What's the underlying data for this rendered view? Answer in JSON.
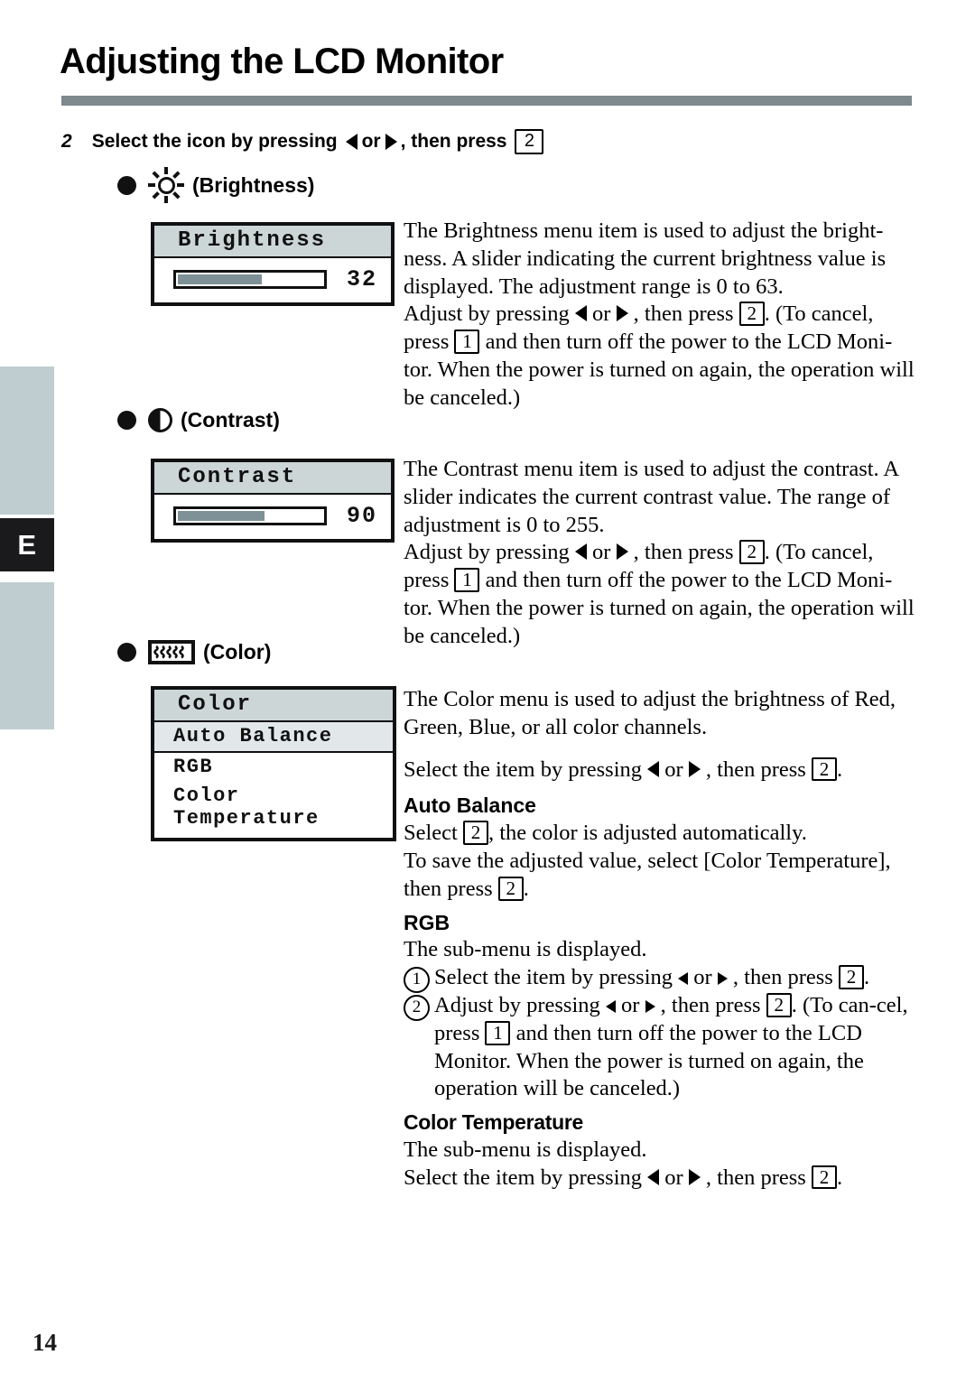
{
  "page": {
    "title": "Adjusting the LCD Monitor",
    "number": "14",
    "margin_tab_letter": "E"
  },
  "step": {
    "number": "2",
    "text_before_arrows": "Select the icon by pressing",
    "or_word": "or",
    "text_after_arrows": ", then press",
    "key": "2"
  },
  "sections": [
    {
      "id": "brightness",
      "icon": "sun-icon",
      "heading": "(Brightness)",
      "osd": {
        "title": "Brightness",
        "value": "32",
        "fill_percent": 58
      },
      "paragraphs": [
        "The Brightness menu item is used to adjust the bright-ness.  A slider indicating the current brightness value is displayed.  The adjustment range is 0 to 63.",
        "Adjust by pressing"
      ],
      "adjust_line": {
        "lead": "Adjust by pressing",
        "or_word": "or",
        "mid": ", then press",
        "key_confirm": "2",
        "after_key": ". (To cancel,",
        "second_lead": "press",
        "key_cancel": "1",
        "tail": "and then turn off the power to the LCD Moni-tor. When the power is turned on again, the operation will be canceled.)"
      }
    },
    {
      "id": "contrast",
      "icon": "contrast-icon",
      "heading": "(Contrast)",
      "osd": {
        "title": "Contrast",
        "value": "90",
        "fill_percent": 60
      },
      "paragraphs": [
        "The Contrast menu item is used to adjust the contrast.  A slider indicates the current contrast value.  The range of adjustment is 0 to 255."
      ],
      "adjust_line": {
        "lead": "Adjust by pressing",
        "or_word": "or",
        "mid": ", then press",
        "key_confirm": "2",
        "after_key": ". (To cancel,",
        "second_lead": "press",
        "key_cancel": "1",
        "tail": "and then turn off the power to the LCD Moni-tor. When the power is turned on again, the operation will be canceled.)"
      }
    },
    {
      "id": "color",
      "icon": "color-bars-icon",
      "heading": "(Color)",
      "osd_menu": {
        "title": "Color",
        "items": [
          {
            "label": "Auto Balance",
            "highlighted": true
          },
          {
            "label": "RGB",
            "highlighted": false
          },
          {
            "label": "Color Temperature",
            "highlighted": false
          }
        ]
      },
      "intro": "The Color menu is used to adjust the brightness of Red, Green, Blue, or all color channels.",
      "select_line": {
        "lead": "Select the item by pressing",
        "or_word": "or",
        "mid": ", then press",
        "key": "2",
        "tail": "."
      },
      "subsections": [
        {
          "title": "Auto Balance",
          "lines": [
            {
              "lead": "Select",
              "key": "2",
              "tail": ", the color is adjusted automatically."
            },
            {
              "lead": "To save the adjusted value, select [Color Temperature], then press",
              "key": "2",
              "tail": "."
            }
          ]
        },
        {
          "title": "RGB",
          "intro": "The sub-menu is displayed.",
          "items": [
            {
              "marker": "1",
              "lead": "Select the item by pressing",
              "or_word": "or",
              "mid": ", then press",
              "key": "2",
              "tail": "."
            },
            {
              "marker": "2",
              "lead": "Adjust by pressing",
              "or_word": "or",
              "mid": ", then press",
              "key": "2",
              "after_key": ". (To can-cel, press",
              "key_cancel": "1",
              "tail": "and then turn off the power to the LCD Monitor. When the power is turned on again, the operation will be canceled.)"
            }
          ]
        },
        {
          "title": "Color Temperature",
          "intro": "The sub-menu is displayed.",
          "select_line": {
            "lead": "Select the item by pressing",
            "or_word": "or",
            "mid": ", then press",
            "key": "2",
            "tail": "."
          }
        }
      ]
    }
  ],
  "colors": {
    "rule": "#7d898c",
    "margin_tab": "#bfcdd0",
    "osd_title_bg": "#ccd6d6",
    "osd_highlight_bg": "#e2e8ea",
    "slider_fill": "#7d9196",
    "tab_letter_bg": "#1a1a1c"
  }
}
